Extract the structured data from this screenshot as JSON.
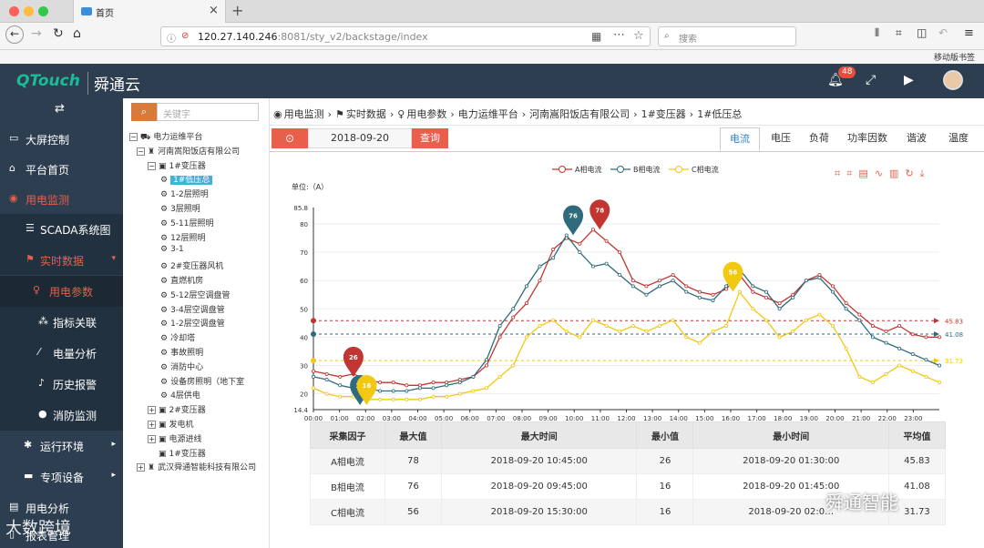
{
  "browser": {
    "tab_title": "首页",
    "url_host": "120.27.140.246",
    "url_rest": ":8081/sty_v2/backstage/index",
    "search_placeholder": "搜索",
    "mobile_bookmarks": "移动版书签"
  },
  "header": {
    "logo_en": "QTouch",
    "logo_cn": "舜通云",
    "notification_count": "48"
  },
  "sidebar": {
    "items": [
      {
        "label": "大屏控制",
        "icon": "monitor-icon"
      },
      {
        "label": "平台首页",
        "icon": "home-icon"
      },
      {
        "label": "用电监测",
        "icon": "eye-icon"
      },
      {
        "label": "SCADA系统图",
        "icon": "scada-icon"
      },
      {
        "label": "实时数据",
        "icon": "flag-icon"
      },
      {
        "label": "用电参数",
        "icon": "bulb-icon"
      },
      {
        "label": "指标关联",
        "icon": "sitemap-icon"
      },
      {
        "label": "电量分析",
        "icon": "wand-icon"
      },
      {
        "label": "历史报警",
        "icon": "bell-icon"
      },
      {
        "label": "消防监测",
        "icon": "dot-icon"
      },
      {
        "label": "运行环境",
        "icon": "asterisk-icon"
      },
      {
        "label": "专项设备",
        "icon": "tv-icon"
      },
      {
        "label": "用电分析",
        "icon": "book-icon"
      },
      {
        "label": "报表管理",
        "icon": "file-icon"
      }
    ]
  },
  "tree": {
    "search_placeholder": "关键字",
    "nodes": [
      "电力运维平台",
      "河南嵩阳饭店有限公司",
      "1#变压器",
      "1#低压总",
      "1-2层照明",
      "3层照明",
      "5-11层照明",
      "12层照明",
      "3-1",
      "2#变压器风机",
      "直燃机房",
      "5-12层空调盘管",
      "3-4层空调盘管",
      "1-2层空调盘管",
      "冷却塔",
      "事故照明",
      "消防中心",
      "设备房照明（地下室",
      "4层供电",
      "2#变压器",
      "发电机",
      "电源进线",
      "1#变压器",
      "武汉舜通智能科技有限公司"
    ]
  },
  "breadcrumb": [
    "用电监测",
    "实时数据",
    "用电参数",
    "电力运维平台",
    "河南嵩阳饭店有限公司",
    "1#变压器",
    "1#低压总"
  ],
  "query": {
    "date": "2018-09-20",
    "button": "查询"
  },
  "metric_tabs": [
    "电流",
    "电压",
    "负荷",
    "功率因数",
    "谐波",
    "温度"
  ],
  "colors": {
    "A": "#c23531",
    "B": "#2f6b7c",
    "C": "#f2c811",
    "accent": "#e8604c",
    "sidebar": "#2c3e50"
  },
  "chart_data": {
    "type": "line",
    "unit_label": "单位:（A）",
    "ylim": [
      14.4,
      85.8
    ],
    "y_ticks": [
      20,
      30,
      40,
      50,
      60,
      70,
      80
    ],
    "y_edge_labels": [
      "85.8",
      "14.4"
    ],
    "x_ticks": [
      "00:00",
      "01:00",
      "02:00",
      "03:00",
      "04:00",
      "05:00",
      "06:00",
      "07:00",
      "08:00",
      "09:00",
      "10:00",
      "11:00",
      "12:00",
      "13:00",
      "14:00",
      "15:00",
      "16:00",
      "17:00",
      "18:00",
      "19:00",
      "20:00",
      "21:00",
      "22:00",
      "23:00"
    ],
    "series": [
      {
        "name": "A相电流",
        "key": "A",
        "values": [
          28,
          27,
          26,
          27,
          25,
          24,
          24,
          23,
          23,
          24,
          24,
          25,
          26,
          30,
          40,
          47,
          52,
          60,
          71,
          75,
          73,
          78,
          74,
          70,
          60,
          58,
          60,
          62,
          58,
          56,
          55,
          57,
          62,
          56,
          54,
          52,
          55,
          60,
          62,
          58,
          52,
          48,
          44,
          42,
          44,
          41,
          40,
          40
        ],
        "max": {
          "label": "78",
          "x": 21.5
        },
        "min": {
          "label": "26",
          "x": 3
        },
        "avg": {
          "label": "45.83",
          "value": 45.83
        }
      },
      {
        "name": "B相电流",
        "key": "B",
        "values": [
          26,
          25,
          23,
          22,
          22,
          21,
          21,
          21,
          22,
          22,
          23,
          24,
          26,
          32,
          44,
          50,
          58,
          65,
          68,
          76,
          70,
          65,
          66,
          62,
          58,
          55,
          58,
          60,
          56,
          54,
          53,
          58,
          64,
          58,
          56,
          50,
          54,
          60,
          61,
          56,
          50,
          46,
          40,
          38,
          36,
          34,
          32,
          30
        ],
        "max": {
          "label": "76",
          "x": 19.5
        },
        "min": {
          "label": "16",
          "x": 3.5
        },
        "avg": {
          "label": "41.08",
          "value": 41.08
        }
      },
      {
        "name": "C相电流",
        "key": "C",
        "values": [
          22,
          20,
          19,
          19,
          18,
          18,
          18,
          18,
          18,
          19,
          19,
          20,
          21,
          22,
          26,
          30,
          40,
          44,
          46,
          42,
          40,
          46,
          44,
          42,
          44,
          42,
          44,
          46,
          40,
          38,
          42,
          44,
          56,
          50,
          46,
          40,
          42,
          46,
          48,
          44,
          36,
          26,
          24,
          27,
          30,
          28,
          26,
          24
        ],
        "max": {
          "label": "56",
          "x": 31.5
        },
        "min": {
          "label": "16",
          "x": 4
        },
        "avg": {
          "label": "31.73",
          "value": 31.73
        }
      }
    ]
  },
  "table": {
    "headers": [
      "采集因子",
      "最大值",
      "最大时间",
      "最小值",
      "最小时间",
      "平均值"
    ],
    "rows": [
      [
        "A相电流",
        "78",
        "2018-09-20 10:45:00",
        "26",
        "2018-09-20 01:30:00",
        "45.83"
      ],
      [
        "B相电流",
        "76",
        "2018-09-20 09:45:00",
        "16",
        "2018-09-20 01:45:00",
        "41.08"
      ],
      [
        "C相电流",
        "56",
        "2018-09-20 15:30:00",
        "16",
        "2018-09-20 02:0…",
        "31.73"
      ]
    ]
  },
  "watermarks": {
    "wechat": "舜通智能",
    "corner": "大数跨境"
  }
}
